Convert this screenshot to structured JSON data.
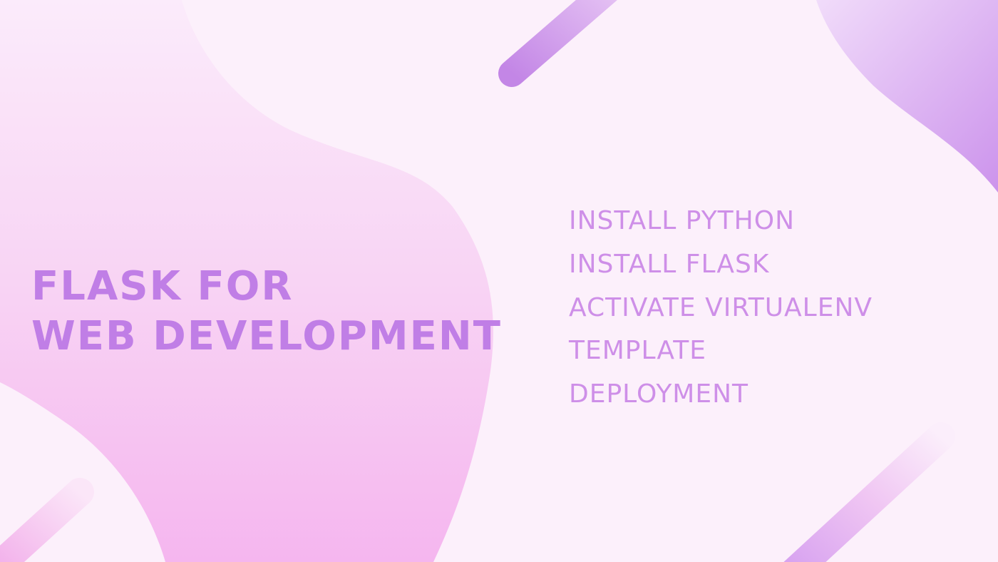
{
  "slide": {
    "title_line_1": "FLASK FOR",
    "title_line_2": "WEB DEVELOPMENT",
    "topics": [
      "INSTALL PYTHON",
      "INSTALL FLASK",
      "ACTIVATE VIRTUALENV",
      "TEMPLATE",
      "DEPLOYMENT"
    ]
  },
  "colors": {
    "background": "#fcf0fb",
    "title": "#c07ee6",
    "topics": "#ce8fe8",
    "accent_purple": "#c78ae8",
    "accent_pink": "#f6b4ef"
  }
}
